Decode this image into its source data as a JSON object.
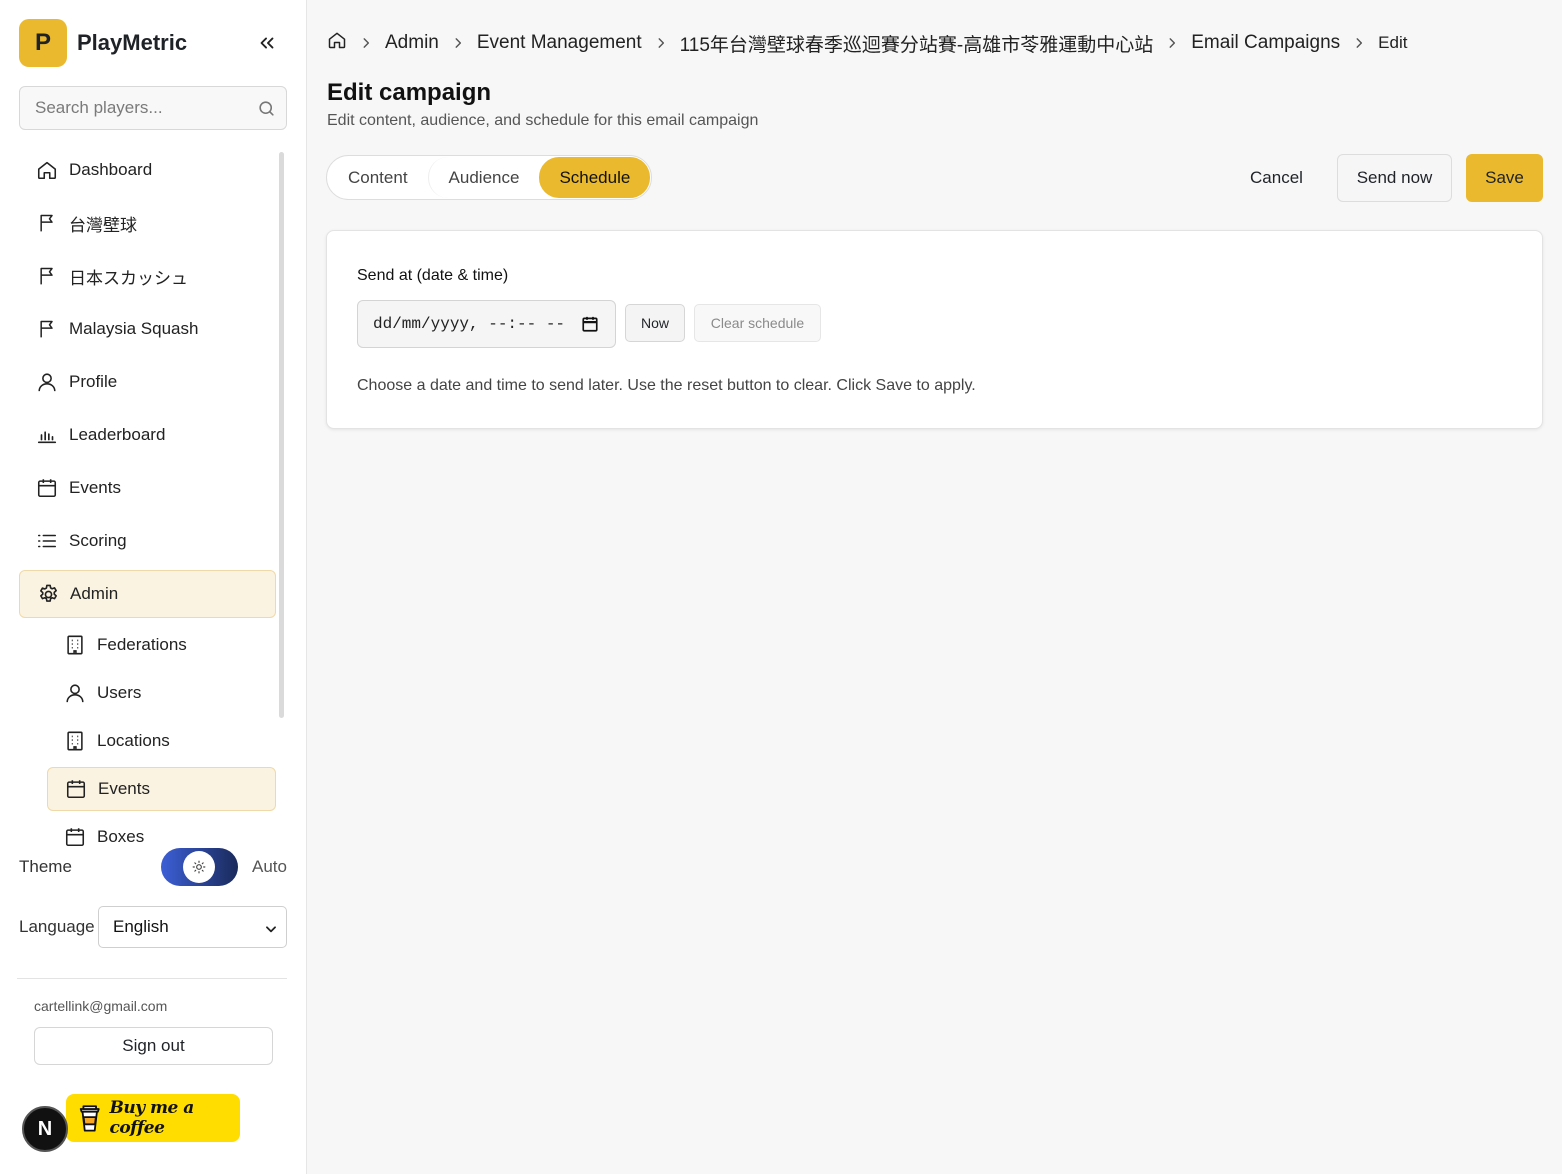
{
  "app": {
    "logo_letter": "P",
    "name": "PlayMetric"
  },
  "search": {
    "placeholder": "Search players..."
  },
  "nav": {
    "items": [
      {
        "label": "Dashboard",
        "icon": "home-icon"
      },
      {
        "label": "台灣壁球",
        "icon": "flag-icon"
      },
      {
        "label": "日本スカッシュ",
        "icon": "flag-icon"
      },
      {
        "label": "Malaysia Squash",
        "icon": "flag-icon"
      },
      {
        "label": "Profile",
        "icon": "user-icon"
      },
      {
        "label": "Leaderboard",
        "icon": "bar-chart-icon"
      },
      {
        "label": "Events",
        "icon": "calendar-icon"
      },
      {
        "label": "Scoring",
        "icon": "list-icon"
      },
      {
        "label": "Admin",
        "icon": "gear-icon",
        "active": true
      }
    ],
    "admin_sub": [
      {
        "label": "Federations",
        "icon": "building-icon"
      },
      {
        "label": "Users",
        "icon": "user-icon"
      },
      {
        "label": "Locations",
        "icon": "building-icon"
      },
      {
        "label": "Events",
        "icon": "calendar-icon",
        "active": true
      },
      {
        "label": "Boxes",
        "icon": "calendar-icon"
      }
    ]
  },
  "theme": {
    "label": "Theme",
    "value": "Auto"
  },
  "language": {
    "label": "Language",
    "selected": "English"
  },
  "account": {
    "email": "cartellink@gmail.com",
    "signout_label": "Sign out"
  },
  "badges": {
    "next": "N",
    "bmc": "Buy me a coffee"
  },
  "breadcrumb": {
    "items": [
      "Admin",
      "Event Management",
      "115年台灣壁球春季巡迴賽分站賽-高雄市苓雅運動中心站",
      "Email Campaigns"
    ],
    "current": "Edit"
  },
  "page": {
    "title": "Edit campaign",
    "subtitle": "Edit content, audience, and schedule for this email campaign"
  },
  "tabs": [
    {
      "label": "Content"
    },
    {
      "label": "Audience"
    },
    {
      "label": "Schedule",
      "active": true
    }
  ],
  "actions": {
    "cancel": "Cancel",
    "send_now": "Send now",
    "save": "Save"
  },
  "schedule": {
    "label": "Send at (date & time)",
    "input_placeholder": "dd/mm/yyyy, --:-- --",
    "now_label": "Now",
    "clear_label": "Clear schedule",
    "help": "Choose a date and time to send later. Use the reset button to clear. Click Save to apply."
  },
  "colors": {
    "accent": "#eab92e",
    "active_bg": "#fbf3e1",
    "bmc": "#ffdd00"
  }
}
